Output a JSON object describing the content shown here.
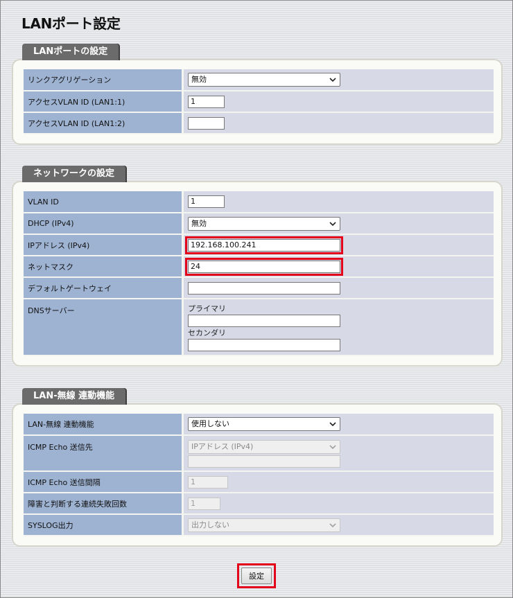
{
  "page_title": "LANポート設定",
  "sections": {
    "lan_port": {
      "tab": "LANポートの設定",
      "rows": {
        "link_aggregation": {
          "label": "リンクアグリゲーション",
          "value": "無効"
        },
        "access_vlan_1": {
          "label": "アクセスVLAN ID (LAN1:1)",
          "value": "1"
        },
        "access_vlan_2": {
          "label": "アクセスVLAN ID (LAN1:2)",
          "value": ""
        }
      }
    },
    "network": {
      "tab": "ネットワークの設定",
      "rows": {
        "vlan_id": {
          "label": "VLAN ID",
          "value": "1"
        },
        "dhcp": {
          "label": "DHCP (IPv4)",
          "value": "無効"
        },
        "ip_address": {
          "label": "IPアドレス (IPv4)",
          "value": "192.168.100.241"
        },
        "netmask": {
          "label": "ネットマスク",
          "value": "24"
        },
        "gateway": {
          "label": "デフォルトゲートウェイ",
          "value": ""
        },
        "dns": {
          "label": "DNSサーバー",
          "primary_label": "プライマリ",
          "primary_value": "",
          "secondary_label": "セカンダリ",
          "secondary_value": ""
        }
      }
    },
    "wireless_link": {
      "tab": "LAN-無線 連動機能",
      "rows": {
        "function": {
          "label": "LAN-無線 連動機能",
          "value": "使用しない"
        },
        "icmp_dest": {
          "label": "ICMP Echo 送信先",
          "value": "IPアドレス (IPv4)",
          "input_value": ""
        },
        "icmp_interval": {
          "label": "ICMP Echo 送信間隔",
          "value": "1"
        },
        "fail_count": {
          "label": "障害と判断する連続失敗回数",
          "value": "1"
        },
        "syslog": {
          "label": "SYSLOG出力",
          "value": "出力しない"
        }
      }
    }
  },
  "submit_label": "設定",
  "colors": {
    "label_bg": "#9eb3d2",
    "value_bg": "#d7dae6",
    "tab_bg": "#6b6b6b",
    "highlight": "#e3001b"
  },
  "icons": {
    "select_arrow": "chevron-down-icon"
  }
}
